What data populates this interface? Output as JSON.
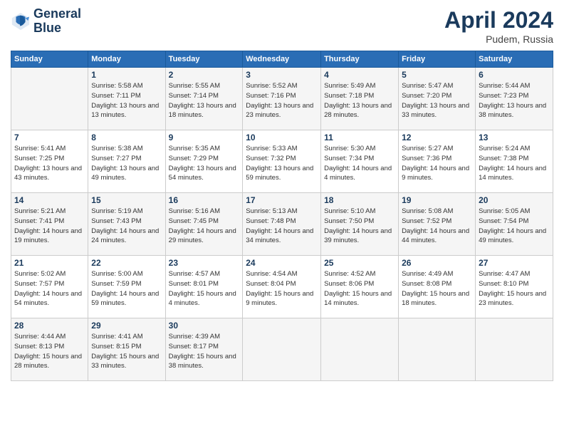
{
  "header": {
    "logo_line1": "General",
    "logo_line2": "Blue",
    "title": "April 2024",
    "subtitle": "Pudem, Russia"
  },
  "days_of_week": [
    "Sunday",
    "Monday",
    "Tuesday",
    "Wednesday",
    "Thursday",
    "Friday",
    "Saturday"
  ],
  "weeks": [
    [
      {
        "day": "",
        "info": ""
      },
      {
        "day": "1",
        "info": "Sunrise: 5:58 AM\nSunset: 7:11 PM\nDaylight: 13 hours\nand 13 minutes."
      },
      {
        "day": "2",
        "info": "Sunrise: 5:55 AM\nSunset: 7:14 PM\nDaylight: 13 hours\nand 18 minutes."
      },
      {
        "day": "3",
        "info": "Sunrise: 5:52 AM\nSunset: 7:16 PM\nDaylight: 13 hours\nand 23 minutes."
      },
      {
        "day": "4",
        "info": "Sunrise: 5:49 AM\nSunset: 7:18 PM\nDaylight: 13 hours\nand 28 minutes."
      },
      {
        "day": "5",
        "info": "Sunrise: 5:47 AM\nSunset: 7:20 PM\nDaylight: 13 hours\nand 33 minutes."
      },
      {
        "day": "6",
        "info": "Sunrise: 5:44 AM\nSunset: 7:23 PM\nDaylight: 13 hours\nand 38 minutes."
      }
    ],
    [
      {
        "day": "7",
        "info": "Sunrise: 5:41 AM\nSunset: 7:25 PM\nDaylight: 13 hours\nand 43 minutes."
      },
      {
        "day": "8",
        "info": "Sunrise: 5:38 AM\nSunset: 7:27 PM\nDaylight: 13 hours\nand 49 minutes."
      },
      {
        "day": "9",
        "info": "Sunrise: 5:35 AM\nSunset: 7:29 PM\nDaylight: 13 hours\nand 54 minutes."
      },
      {
        "day": "10",
        "info": "Sunrise: 5:33 AM\nSunset: 7:32 PM\nDaylight: 13 hours\nand 59 minutes."
      },
      {
        "day": "11",
        "info": "Sunrise: 5:30 AM\nSunset: 7:34 PM\nDaylight: 14 hours\nand 4 minutes."
      },
      {
        "day": "12",
        "info": "Sunrise: 5:27 AM\nSunset: 7:36 PM\nDaylight: 14 hours\nand 9 minutes."
      },
      {
        "day": "13",
        "info": "Sunrise: 5:24 AM\nSunset: 7:38 PM\nDaylight: 14 hours\nand 14 minutes."
      }
    ],
    [
      {
        "day": "14",
        "info": "Sunrise: 5:21 AM\nSunset: 7:41 PM\nDaylight: 14 hours\nand 19 minutes."
      },
      {
        "day": "15",
        "info": "Sunrise: 5:19 AM\nSunset: 7:43 PM\nDaylight: 14 hours\nand 24 minutes."
      },
      {
        "day": "16",
        "info": "Sunrise: 5:16 AM\nSunset: 7:45 PM\nDaylight: 14 hours\nand 29 minutes."
      },
      {
        "day": "17",
        "info": "Sunrise: 5:13 AM\nSunset: 7:48 PM\nDaylight: 14 hours\nand 34 minutes."
      },
      {
        "day": "18",
        "info": "Sunrise: 5:10 AM\nSunset: 7:50 PM\nDaylight: 14 hours\nand 39 minutes."
      },
      {
        "day": "19",
        "info": "Sunrise: 5:08 AM\nSunset: 7:52 PM\nDaylight: 14 hours\nand 44 minutes."
      },
      {
        "day": "20",
        "info": "Sunrise: 5:05 AM\nSunset: 7:54 PM\nDaylight: 14 hours\nand 49 minutes."
      }
    ],
    [
      {
        "day": "21",
        "info": "Sunrise: 5:02 AM\nSunset: 7:57 PM\nDaylight: 14 hours\nand 54 minutes."
      },
      {
        "day": "22",
        "info": "Sunrise: 5:00 AM\nSunset: 7:59 PM\nDaylight: 14 hours\nand 59 minutes."
      },
      {
        "day": "23",
        "info": "Sunrise: 4:57 AM\nSunset: 8:01 PM\nDaylight: 15 hours\nand 4 minutes."
      },
      {
        "day": "24",
        "info": "Sunrise: 4:54 AM\nSunset: 8:04 PM\nDaylight: 15 hours\nand 9 minutes."
      },
      {
        "day": "25",
        "info": "Sunrise: 4:52 AM\nSunset: 8:06 PM\nDaylight: 15 hours\nand 14 minutes."
      },
      {
        "day": "26",
        "info": "Sunrise: 4:49 AM\nSunset: 8:08 PM\nDaylight: 15 hours\nand 18 minutes."
      },
      {
        "day": "27",
        "info": "Sunrise: 4:47 AM\nSunset: 8:10 PM\nDaylight: 15 hours\nand 23 minutes."
      }
    ],
    [
      {
        "day": "28",
        "info": "Sunrise: 4:44 AM\nSunset: 8:13 PM\nDaylight: 15 hours\nand 28 minutes."
      },
      {
        "day": "29",
        "info": "Sunrise: 4:41 AM\nSunset: 8:15 PM\nDaylight: 15 hours\nand 33 minutes."
      },
      {
        "day": "30",
        "info": "Sunrise: 4:39 AM\nSunset: 8:17 PM\nDaylight: 15 hours\nand 38 minutes."
      },
      {
        "day": "",
        "info": ""
      },
      {
        "day": "",
        "info": ""
      },
      {
        "day": "",
        "info": ""
      },
      {
        "day": "",
        "info": ""
      }
    ]
  ]
}
